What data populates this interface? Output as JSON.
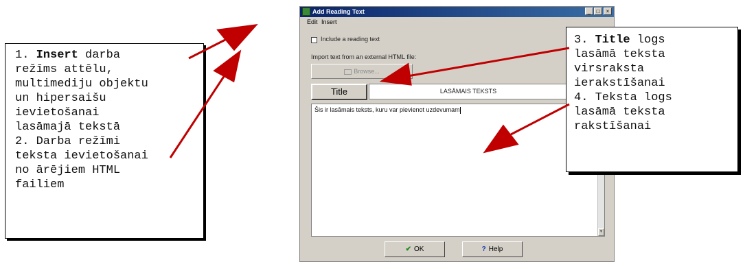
{
  "callouts": {
    "left": {
      "lines": [
        {
          "pre": "1. ",
          "bold": "Insert",
          "post": " darba"
        },
        {
          "pre": "režīms attēlu,",
          "bold": "",
          "post": ""
        },
        {
          "pre": "multimediju objektu",
          "bold": "",
          "post": ""
        },
        {
          "pre": "un hipersaišu",
          "bold": "",
          "post": ""
        },
        {
          "pre": "ievietošanai",
          "bold": "",
          "post": ""
        },
        {
          "pre": "lasāmajā tekstā",
          "bold": "",
          "post": ""
        },
        {
          "pre": "2. Darba režīmi",
          "bold": "",
          "post": ""
        },
        {
          "pre": "teksta ievietošanai",
          "bold": "",
          "post": ""
        },
        {
          "pre": "no ārējiem HTML",
          "bold": "",
          "post": ""
        },
        {
          "pre": "failiem",
          "bold": "",
          "post": ""
        }
      ]
    },
    "right": {
      "lines": [
        {
          "pre": "3. ",
          "bold": "Title",
          "post": " logs"
        },
        {
          "pre": "lasāmā teksta",
          "bold": "",
          "post": ""
        },
        {
          "pre": "virsraksta",
          "bold": "",
          "post": ""
        },
        {
          "pre": "ierakstīšanai",
          "bold": "",
          "post": ""
        },
        {
          "pre": "4. Teksta logs",
          "bold": "",
          "post": ""
        },
        {
          "pre": "lasāmā teksta",
          "bold": "",
          "post": ""
        },
        {
          "pre": "rakstīšanai",
          "bold": "",
          "post": ""
        }
      ]
    }
  },
  "dialog": {
    "title": "Add Reading Text",
    "window_buttons": {
      "minimize": "_",
      "maximize": "□",
      "close": "×"
    },
    "menu": {
      "edit": "Edit",
      "insert": "Insert"
    },
    "include_label": "Include a reading text",
    "include_checked": false,
    "import_label": "Import text from an external HTML file:",
    "browse_label": "Browse...",
    "title_button": "Title",
    "title_value": "LASĀMAIS TEKSTS",
    "body_text": "Šis ir lasāmais teksts, kuru var pievienot uzdevumam",
    "ok_label": "OK",
    "help_label": "Help",
    "ok_glyph": "✔",
    "help_glyph": "?",
    "scroll_glyph": "▼"
  },
  "colors": {
    "arrow": "#c00000",
    "titlebar_start": "#0a246a",
    "titlebar_end": "#3a6ea5",
    "dialog_face": "#d4d0c8"
  }
}
